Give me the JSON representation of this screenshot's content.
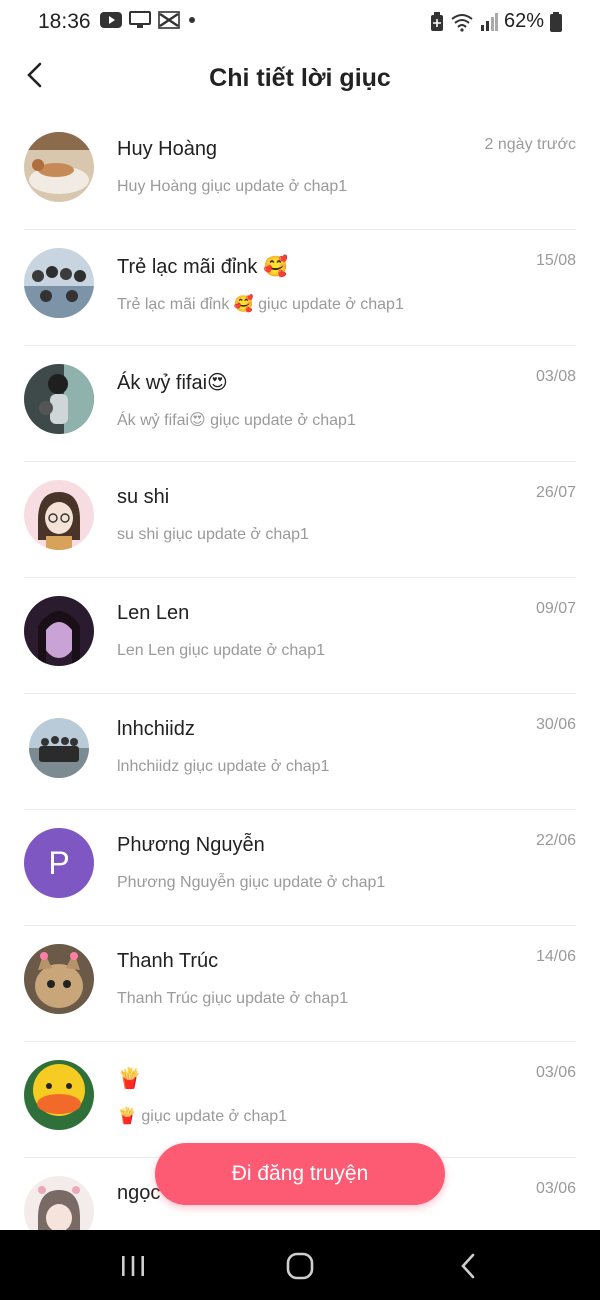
{
  "status_bar": {
    "time": "18:36",
    "battery": "62%",
    "left_icons": [
      "youtube-icon",
      "cast-screen-icon",
      "capcut-icon",
      "dot-icon"
    ],
    "right_icons": [
      "battery-saver-icon",
      "wifi-icon",
      "signal-icon",
      "battery-icon"
    ]
  },
  "header": {
    "title": "Chi tiết lời giục",
    "back_icon": "back-arrow-icon"
  },
  "colors": {
    "accent": "#fd5a74",
    "secondary_text": "#9a9a9a",
    "avatar_letter_bg": "#7e57c2"
  },
  "rows": [
    {
      "name": "Huy Hoàng",
      "date": "2 ngày trước",
      "message": "Huy Hoàng giục update ở chap1"
    },
    {
      "name": "Trẻ lạc mãi đỉnk 🥰",
      "date": "15/08",
      "message": "Trẻ lạc mãi đỉnk 🥰 giục update ở chap1"
    },
    {
      "name": "Ák wỷ fifai😍",
      "date": "03/08",
      "message": "Ák wỷ fifai😍 giục update ở chap1"
    },
    {
      "name": "su shi",
      "date": "26/07",
      "message": "su shi giục update ở chap1"
    },
    {
      "name": "Len Len",
      "date": "09/07",
      "message": "Len Len giục update ở chap1"
    },
    {
      "name": "lnhchiidz",
      "date": "30/06",
      "message": "lnhchiidz giục update ở chap1"
    },
    {
      "name": "Phương Nguyễn",
      "date": "22/06",
      "message": "Phương Nguyễn giục update ở chap1",
      "avatar_letter": "P"
    },
    {
      "name": "Thanh Trúc",
      "date": "14/06",
      "message": "Thanh Trúc giục update ở chap1"
    },
    {
      "name": "🍟",
      "date": "03/06",
      "message": "🍟 giục update ở chap1"
    },
    {
      "name": "ngọc ngọ",
      "date": "03/06",
      "message": ""
    }
  ],
  "cta": {
    "label": "Đi đăng truyện"
  },
  "navbar": {
    "icons": [
      "recent-apps-icon",
      "home-icon",
      "back-icon"
    ]
  }
}
